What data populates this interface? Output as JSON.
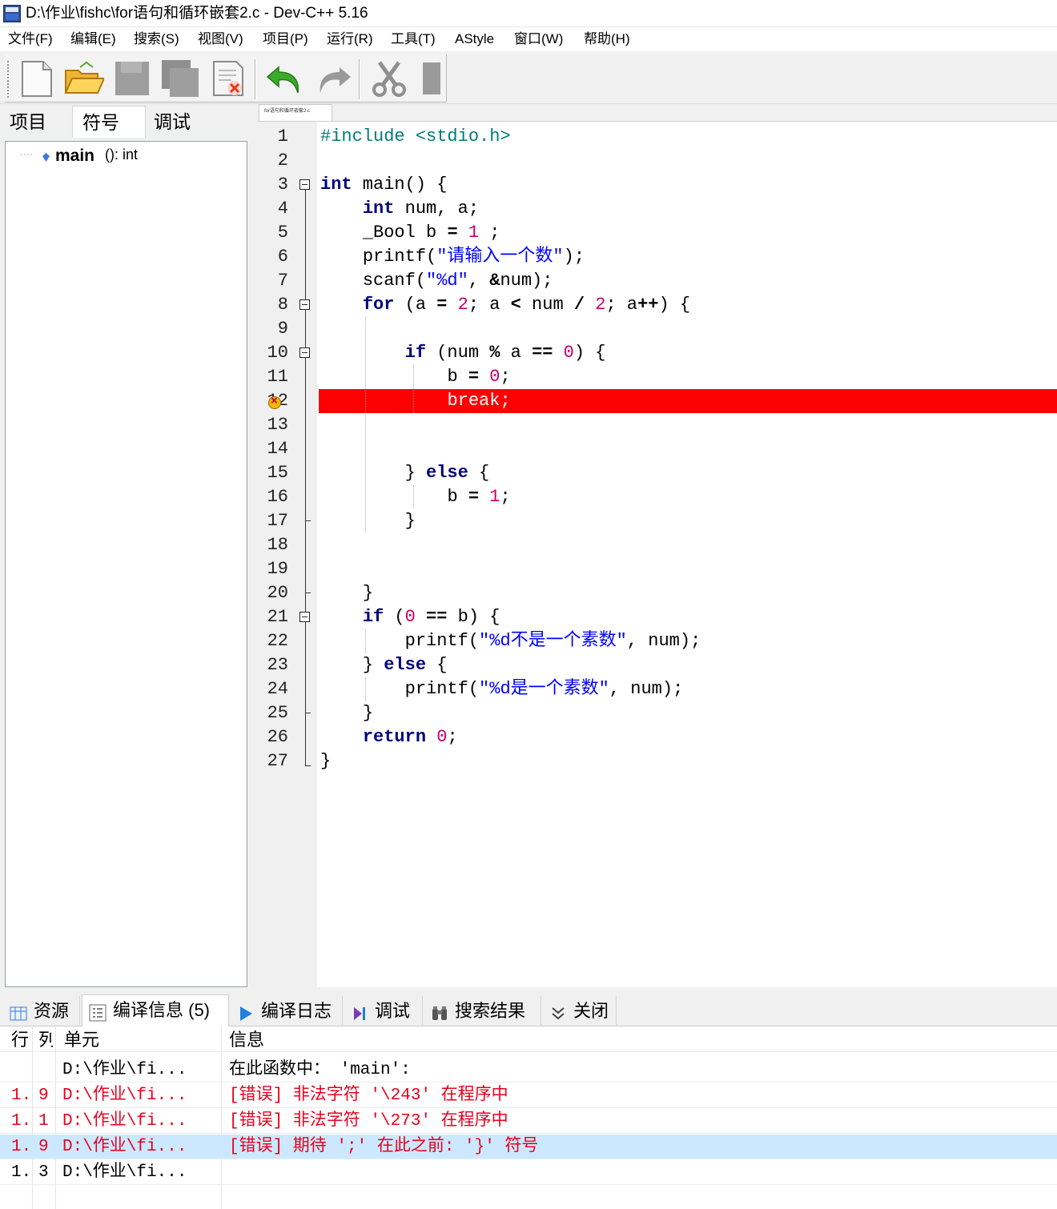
{
  "window": {
    "title": "D:\\作业\\fishc\\for语句和循环嵌套2.c - Dev-C++ 5.16"
  },
  "menu": [
    "文件(F)",
    "编辑(E)",
    "搜索(S)",
    "视图(V)",
    "项目(P)",
    "运行(R)",
    "工具(T)",
    "AStyle",
    "窗口(W)",
    "帮助(H)"
  ],
  "toolbar": {
    "icons": [
      "new-file-icon",
      "open-folder-icon",
      "save-icon",
      "save-all-icon",
      "close-file-icon",
      "undo-icon",
      "redo-icon",
      "cut-icon",
      "copy-icon"
    ]
  },
  "left_tabs": [
    "项目",
    "符号",
    "调试"
  ],
  "symbols": {
    "name": "main",
    "signature": "(): int"
  },
  "editor": {
    "file_tab": "for语句和循环嵌套2.c",
    "line_numbers": [
      "1",
      "2",
      "3",
      "4",
      "5",
      "6",
      "7",
      "8",
      "9",
      "10",
      "11",
      "12",
      "13",
      "14",
      "15",
      "16",
      "17",
      "18",
      "19",
      "20",
      "21",
      "22",
      "23",
      "24",
      "25",
      "26",
      "27"
    ],
    "code": {
      "l1_pp": "#include <stdio.h>",
      "l3_kw": "int",
      "l3_rest": " main() {",
      "l4_kw": "int",
      "l4_rest": " num, a;",
      "l5_a": "_Bool b ",
      "l5_op": "=",
      "l5_b": " ",
      "l5_num": "1",
      "l5_c": " ;",
      "l6_a": "printf(",
      "l6_str": "\"请输入一个数\"",
      "l6_b": ");",
      "l7_a": "scanf(",
      "l7_str": "\"%d\"",
      "l7_b": ", ",
      "l7_op": "&",
      "l7_c": "num);",
      "l8_kw": "for",
      "l8_a": " (a ",
      "l8_op1": "=",
      "l8_b": " ",
      "l8_n1": "2",
      "l8_c": "; a ",
      "l8_op2": "<",
      "l8_d": " num ",
      "l8_op3": "/",
      "l8_e": " ",
      "l8_n2": "2",
      "l8_f": "; a",
      "l8_op4": "++",
      "l8_g": ") {",
      "l10_kw": "if",
      "l10_a": " (num ",
      "l10_op1": "%",
      "l10_b": " a ",
      "l10_op2": "==",
      "l10_c": " ",
      "l10_num": "0",
      "l10_d": ") {",
      "l11_a": "b ",
      "l11_op": "=",
      "l11_b": " ",
      "l11_num": "0",
      "l11_c": ";",
      "l12": "break;",
      "l15_a": "} ",
      "l15_kw": "else",
      "l15_b": " {",
      "l16_a": "b ",
      "l16_op": "=",
      "l16_b": " ",
      "l16_num": "1",
      "l16_c": ";",
      "l17": "}",
      "l20": "}",
      "l21_kw": "if",
      "l21_a": " (",
      "l21_num": "0",
      "l21_b": " ",
      "l21_op": "==",
      "l21_c": " b) {",
      "l22_a": "printf(",
      "l22_str": "\"%d不是一个素数\"",
      "l22_b": ", num);",
      "l23_a": "} ",
      "l23_kw": "else",
      "l23_b": " {",
      "l24_a": "printf(",
      "l24_str": "\"%d是一个素数\"",
      "l24_b": ", num);",
      "l25": "}",
      "l26_kw": "return",
      "l26_a": " ",
      "l26_num": "0",
      "l26_b": ";",
      "l27": "}"
    }
  },
  "bottom_tabs": [
    "资源",
    "编译信息 (5)",
    "编译日志",
    "调试",
    "搜索结果",
    "关闭"
  ],
  "messages": {
    "headers": {
      "line": "行",
      "col": "列",
      "unit": "单元",
      "info": "信息"
    },
    "rows": [
      {
        "line": "",
        "col": "",
        "unit": "D:\\作业\\fi...",
        "info": "在此函数中： 'main':"
      },
      {
        "line": "1.",
        "col": "9",
        "unit": "D:\\作业\\fi...",
        "info": "[错误] 非法字符 '\\243' 在程序中"
      },
      {
        "line": "1.",
        "col": "1",
        "unit": "D:\\作业\\fi...",
        "info": "[错误] 非法字符 '\\273' 在程序中"
      },
      {
        "line": "1.",
        "col": "9",
        "unit": "D:\\作业\\fi...",
        "info": "[错误] 期待 ';' 在此之前: '}' 符号"
      },
      {
        "line": "1.",
        "col": "3",
        "unit": "D:\\作业\\fi...",
        "info": ""
      }
    ]
  },
  "colors": {
    "error_line": "#ff0000",
    "keyword": "#00007b",
    "string": "#0000ff",
    "number": "#c8006b",
    "preprocessor": "#007b7b",
    "error_text": "#e8001c",
    "selected_row": "#cce8ff"
  }
}
